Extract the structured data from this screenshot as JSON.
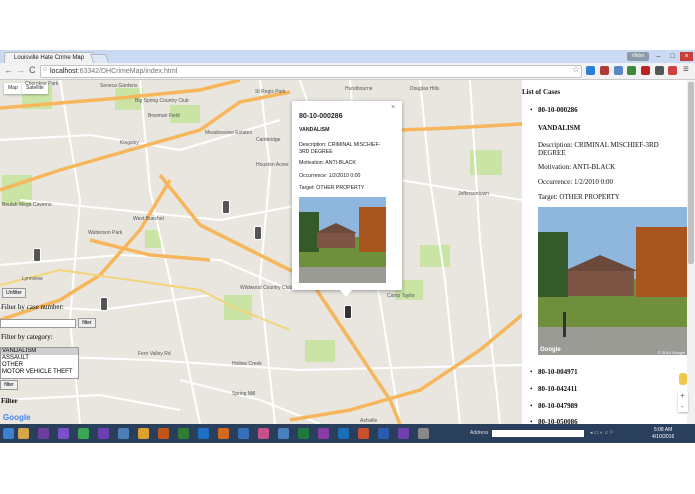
{
  "browser": {
    "tab_title": "Louisville Hate Crime Map",
    "tab_close": "×",
    "url_host": "localhost",
    "url_rest": ":63342/DHCrimeMap/index.html",
    "user_button": "Viktor",
    "window_controls": [
      "–",
      "□",
      "×"
    ],
    "nav": {
      "back": "←",
      "forward": "→",
      "reload": "C"
    },
    "menu_icon": "≡",
    "star_icon": "☆"
  },
  "map": {
    "type_buttons": [
      "Map",
      "Satellite"
    ],
    "places": [
      "Cherokee Park",
      "Seneca Gardens",
      "Bowman Field",
      "Big Spring Country Club",
      "St Regis Park",
      "Hurstbourne",
      "Douglas Hills",
      "Kingsley",
      "Meadowview Estates",
      "Cambridge",
      "Houston Acres",
      "Jeffersontown",
      "West Buechel",
      "Watterson Park",
      "Wildwood Country Club",
      "Camp Taylor",
      "Lynnview",
      "Hollow Creek",
      "Fern Valley Rd",
      "Spring Mill",
      "Ashville",
      "Beulah Mega Caverns"
    ],
    "unfilter_label": "Unfilter",
    "filter_by_case_label": "Filter by case number:",
    "case_filter_button": "filter",
    "filter_by_category_label": "Filter by category:",
    "categories": [
      "VANDALISM",
      "ASSAULT",
      "OTHER",
      "MOTOR VEHICLE THEFT"
    ],
    "selected_category": "VANDALISM",
    "category_filter_button": "filter",
    "filter_heading": "Filter",
    "google_logo": "Google",
    "attribution": "Map data ©2016 Google   Terms of Use   Report a map error"
  },
  "infowindow": {
    "case_number": "80-10-000286",
    "category": "VANDALISM",
    "description": "Description: CRIMINAL MISCHIEF-",
    "description_line2": "3RD DEGREE",
    "motivation": "Motivation: ANTI-BLACK",
    "occurrence": "Occurrence: 1/2/2010 0:00",
    "target": "Target: OTHER PROPERTY",
    "close_icon": "×"
  },
  "sidebar": {
    "heading": "List of Cases",
    "selected_case": "80-10-000286",
    "category": "VANDALISM",
    "description": "Description: CRIMINAL MISCHIEF-3RD",
    "description_line2": "DEGREE",
    "motivation": "Motivation: ANTI-BLACK",
    "occurrence": "Occurrence: 1/2/2010 0:00",
    "target": "Target: OTHER PROPERTY",
    "photo_google": "Google",
    "photo_credit": "© 2014 Google",
    "other_cases": [
      "80-10-004971",
      "80-10-042411",
      "80-10-047989",
      "80-10-050086"
    ]
  },
  "taskbar": {
    "address_label": "Address",
    "time": "5:08 AM",
    "date": "4/10/2016",
    "apps": [
      "file-explorer",
      "visual-studio-blue",
      "visual-studio-purple",
      "android-studio",
      "app-purple",
      "app-photo",
      "chrome",
      "bridge",
      "dreamweaver",
      "photoshop",
      "illustrator",
      "app-blue",
      "app-pink",
      "app-globe",
      "excel",
      "onenote",
      "outlook",
      "powerpoint",
      "word",
      "app-purple-2",
      "app-gray"
    ]
  },
  "colors": {
    "map_bg": "#e8e6df",
    "highway": "#f7b65c",
    "road": "#ffffff",
    "park": "#c9e4a5",
    "taskbar": "#2a3f5c",
    "chrome_title": "#c9daf2"
  }
}
